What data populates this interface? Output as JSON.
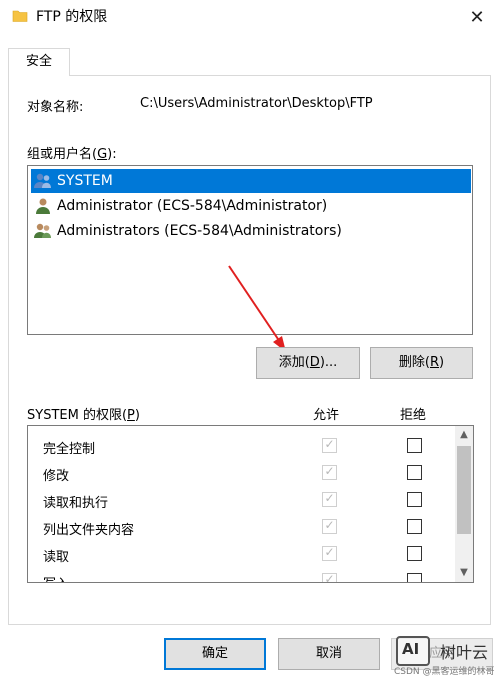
{
  "window": {
    "title": "FTP 的权限",
    "close_glyph": "✕"
  },
  "tab": {
    "label": "安全"
  },
  "object": {
    "label": "对象名称:",
    "value": "C:\\Users\\Administrator\\Desktop\\FTP"
  },
  "groups": {
    "label_prefix": "组或用户名(",
    "label_key": "G",
    "label_suffix": "):",
    "users": [
      {
        "name": "SYSTEM",
        "icon": "users-group-icon",
        "selected": true
      },
      {
        "name": "Administrator (ECS-584\\Administrator)",
        "icon": "user-icon",
        "selected": false
      },
      {
        "name": "Administrators (ECS-584\\Administrators)",
        "icon": "users-group-icon",
        "selected": false
      }
    ]
  },
  "buttons": {
    "add_prefix": "添加(",
    "add_key": "D",
    "add_suffix": ")...",
    "delete_prefix": "删除(",
    "delete_key": "R",
    "delete_suffix": ")",
    "ok": "确定",
    "cancel": "取消",
    "apply": "应用"
  },
  "permissions": {
    "title_prefix": "SYSTEM 的权限(",
    "title_key": "P",
    "title_suffix": ")",
    "allow_header": "允许",
    "deny_header": "拒绝",
    "rows": [
      {
        "name": "完全控制",
        "allow": true,
        "deny": false
      },
      {
        "name": "修改",
        "allow": true,
        "deny": false
      },
      {
        "name": "读取和执行",
        "allow": true,
        "deny": false
      },
      {
        "name": "列出文件夹内容",
        "allow": true,
        "deny": false
      },
      {
        "name": "读取",
        "allow": true,
        "deny": false
      },
      {
        "name": "写入",
        "allow": true,
        "deny": false
      }
    ]
  },
  "watermark": {
    "logo_text": "AI",
    "name": "树叶云",
    "sub": "CSDN @黑客运维的林哥"
  },
  "colors": {
    "selection": "#0078d7",
    "arrow": "#e02020",
    "folder": "#f6c343"
  }
}
